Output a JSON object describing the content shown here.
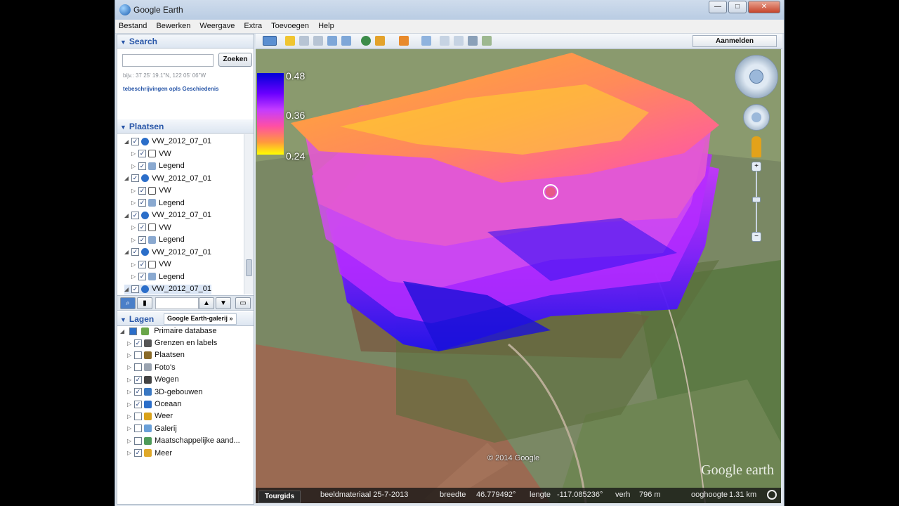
{
  "window": {
    "title": "Google Earth",
    "min": "—",
    "max": "□",
    "close": "✕"
  },
  "menu": [
    "Bestand",
    "Bewerken",
    "Weergave",
    "Extra",
    "Toevoegen",
    "Help"
  ],
  "search": {
    "header": "Search",
    "button": "Zoeken",
    "hint": "bijv.: 37 25' 19.1\"N, 122 05' 06\"W",
    "links": "tebeschrijvingen opls Geschiedenis"
  },
  "places": {
    "header": "Plaatsen",
    "rows": [
      {
        "label": "VW_2012_07_01",
        "kind": "group"
      },
      {
        "label": "VW",
        "kind": "child"
      },
      {
        "label": "Legend",
        "kind": "child"
      },
      {
        "label": "VW_2012_07_01",
        "kind": "group"
      },
      {
        "label": "VW",
        "kind": "child"
      },
      {
        "label": "Legend",
        "kind": "child"
      },
      {
        "label": "VW_2012_07_01",
        "kind": "group"
      },
      {
        "label": "VW",
        "kind": "child"
      },
      {
        "label": "Legend",
        "kind": "child"
      },
      {
        "label": "VW_2012_07_01",
        "kind": "group"
      },
      {
        "label": "VW",
        "kind": "child"
      },
      {
        "label": "Legend",
        "kind": "child"
      },
      {
        "label": "VW_2012_07_01",
        "kind": "group"
      }
    ]
  },
  "layers": {
    "header": "Lagen",
    "tab": "Google Earth-galerij",
    "tab_more": "»",
    "root": "Primaire database",
    "items": [
      {
        "label": "Grenzen en labels",
        "checked": true,
        "icon_color": "#555555"
      },
      {
        "label": "Plaatsen",
        "checked": false,
        "icon_color": "#8a6b2a"
      },
      {
        "label": "Foto's",
        "checked": false,
        "icon_color": "#9aa4b1"
      },
      {
        "label": "Wegen",
        "checked": true,
        "icon_color": "#444444"
      },
      {
        "label": "3D-gebouwen",
        "checked": true,
        "icon_color": "#3a78c2"
      },
      {
        "label": "Oceaan",
        "checked": true,
        "icon_color": "#2b6ec9"
      },
      {
        "label": "Weer",
        "checked": false,
        "icon_color": "#d9a21a"
      },
      {
        "label": "Galerij",
        "checked": false,
        "icon_color": "#6aa0d8"
      },
      {
        "label": "Maatschappelijke aand...",
        "checked": false,
        "icon_color": "#4f9b5a"
      },
      {
        "label": "Meer",
        "checked": true,
        "icon_color": "#e0a92a"
      }
    ]
  },
  "toolbar": {
    "signin": "Aanmelden"
  },
  "legend": {
    "max": "0.48",
    "mid": "0.36",
    "min": "0.24"
  },
  "map": {
    "copyright": "© 2014 Google",
    "logo": "Google earth"
  },
  "status": {
    "tourgids": "Tourgids",
    "date": "beeldmateriaal 25-7-2013",
    "lat_label": "breedte",
    "lat": "46.779492°",
    "lon_label": "lengte",
    "lon": "-117.085236°",
    "elev_label": "verh",
    "elev": "796 m",
    "eye_label": "ooghoogte",
    "eye": "1.31 km"
  },
  "colors": {
    "accent": "#2856a8",
    "legend_low": "#ffff00",
    "legend_high": "#0000d8"
  }
}
